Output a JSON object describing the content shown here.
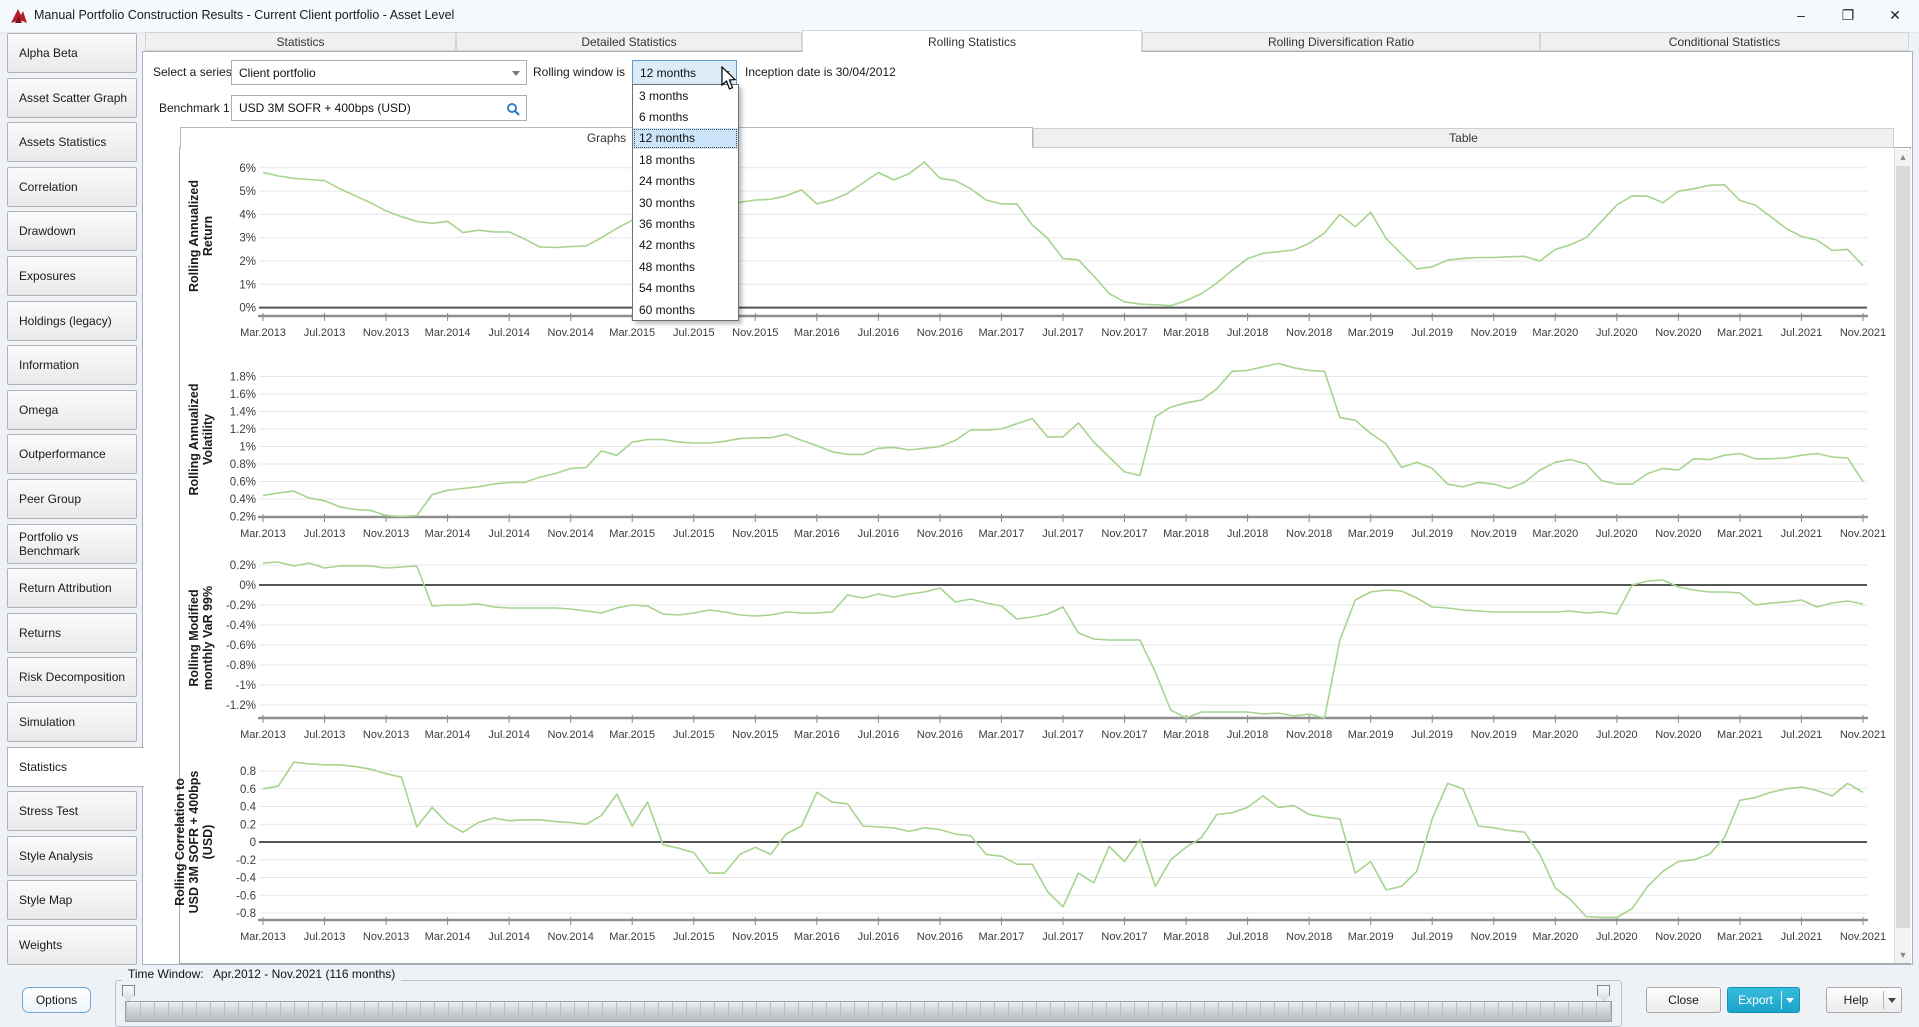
{
  "window": {
    "title": "Manual Portfolio Construction Results - Current Client portfolio - Asset Level",
    "icons": {
      "app": "portfolio-app-icon",
      "minimize": "minimize-icon",
      "restore": "restore-icon",
      "close": "close-icon"
    }
  },
  "sidebar": {
    "items": [
      "Alpha Beta",
      "Asset Scatter Graph",
      "Assets Statistics",
      "Correlation",
      "Drawdown",
      "Exposures",
      "Holdings (legacy)",
      "Information",
      "Omega",
      "Outperformance",
      "Peer Group",
      "Portfolio vs Benchmark",
      "Return Attribution",
      "Returns",
      "Risk Decomposition",
      "Simulation",
      "Statistics",
      "Stress Test",
      "Style Analysis",
      "Style Map",
      "Weights"
    ],
    "active": "Statistics"
  },
  "tabs": {
    "items": [
      "Statistics",
      "Detailed Statistics",
      "Rolling Statistics",
      "Rolling Diversification Ratio",
      "Conditional Statistics"
    ],
    "active": "Rolling Statistics"
  },
  "controls": {
    "series_label": "Select a series",
    "series_value": "Client portfolio",
    "rolling_label": "Rolling window is",
    "rolling_value": "12 months",
    "rolling_options": [
      "3 months",
      "6 months",
      "12 months",
      "18 months",
      "24 months",
      "30 months",
      "36 months",
      "42 months",
      "48 months",
      "54 months",
      "60 months"
    ],
    "rolling_selected": "12 months",
    "inception_text": "Inception date is 30/04/2012",
    "benchmark_label": "Benchmark 1",
    "benchmark_value": "USD 3M SOFR + 400bps (USD)",
    "search_icon": "search-icon"
  },
  "subtabs": {
    "items": [
      "Graphs",
      "Table"
    ],
    "active": "Graphs"
  },
  "colors": {
    "chart_line": "#a6d48e",
    "export_button": "#29b4d6",
    "dropdown_highlight": "#cbe4fa"
  },
  "chart_data": {
    "type": "line",
    "series_name": "Client portfolio",
    "x_start": "Mar.2013",
    "x_step_months": 1,
    "x_labels": [
      "Mar.2013",
      "Jul.2013",
      "Nov.2013",
      "Mar.2014",
      "Jul.2014",
      "Nov.2014",
      "Mar.2015",
      "Jul.2015",
      "Nov.2015",
      "Mar.2016",
      "Jul.2016",
      "Nov.2016",
      "Mar.2017",
      "Jul.2017",
      "Nov.2017",
      "Mar.2018",
      "Jul.2018",
      "Nov.2018",
      "Mar.2019",
      "Jul.2019",
      "Nov.2019",
      "Mar.2020",
      "Jul.2020",
      "Nov.2020",
      "Mar.2021",
      "Jul.2021",
      "Nov.2021"
    ],
    "charts": [
      {
        "ylabel_lines": [
          "Rolling Annualized",
          "Return"
        ],
        "ytick_values": [
          6,
          5,
          4,
          3,
          2,
          1,
          0
        ],
        "ytick_labels": [
          "6%",
          "5%",
          "4%",
          "3%",
          "2%",
          "1%",
          "0%"
        ],
        "ylim": [
          -0.4,
          6.5
        ],
        "values": [
          5.8,
          5.65,
          5.55,
          5.5,
          5.45,
          5.1,
          4.8,
          4.5,
          4.15,
          3.9,
          3.7,
          3.62,
          3.7,
          3.22,
          3.32,
          3.25,
          3.25,
          2.95,
          2.6,
          2.58,
          2.62,
          2.65,
          3.0,
          3.4,
          3.75,
          3.95,
          4.1,
          4.2,
          4.28,
          4.35,
          4.45,
          4.52,
          4.62,
          4.65,
          4.8,
          5.05,
          4.45,
          4.62,
          4.9,
          5.35,
          5.8,
          5.48,
          5.75,
          6.25,
          5.55,
          5.45,
          5.1,
          4.62,
          4.45,
          4.45,
          3.55,
          2.97,
          2.1,
          2.05,
          1.35,
          0.6,
          0.25,
          0.15,
          0.12,
          0.08,
          0.3,
          0.6,
          1.05,
          1.6,
          2.1,
          2.33,
          2.4,
          2.47,
          2.76,
          3.2,
          4.0,
          3.47,
          4.09,
          2.97,
          2.3,
          1.66,
          1.75,
          2.04,
          2.11,
          2.15,
          2.15,
          2.18,
          2.2,
          2.0,
          2.5,
          2.7,
          3.0,
          3.7,
          4.4,
          4.8,
          4.78,
          4.5,
          5.0,
          5.1,
          5.25,
          5.27,
          4.6,
          4.4,
          3.9,
          3.4,
          3.05,
          2.9,
          2.45,
          2.5,
          1.8
        ]
      },
      {
        "ylabel_lines": [
          "Rolling Annualized",
          "Volatility"
        ],
        "ytick_values": [
          1.8,
          1.6,
          1.4,
          1.2,
          1.0,
          0.8,
          0.6,
          0.4,
          0.2
        ],
        "ytick_labels": [
          "1.8%",
          "1.6%",
          "1.4%",
          "1.2%",
          "1%",
          "0.8%",
          "0.6%",
          "0.4%",
          "0.2%"
        ],
        "ylim": [
          0.2,
          2.0
        ],
        "values": [
          0.44,
          0.47,
          0.49,
          0.41,
          0.38,
          0.31,
          0.28,
          0.27,
          0.21,
          0.2,
          0.21,
          0.45,
          0.5,
          0.52,
          0.54,
          0.57,
          0.59,
          0.59,
          0.65,
          0.69,
          0.75,
          0.76,
          0.95,
          0.9,
          1.05,
          1.08,
          1.08,
          1.05,
          1.04,
          1.04,
          1.06,
          1.09,
          1.1,
          1.1,
          1.14,
          1.07,
          1.01,
          0.94,
          0.91,
          0.91,
          0.98,
          0.99,
          0.96,
          0.98,
          1.0,
          1.07,
          1.19,
          1.19,
          1.2,
          1.26,
          1.32,
          1.11,
          1.11,
          1.27,
          1.05,
          0.88,
          0.71,
          0.67,
          1.34,
          1.45,
          1.5,
          1.53,
          1.66,
          1.86,
          1.87,
          1.91,
          1.95,
          1.9,
          1.87,
          1.86,
          1.33,
          1.3,
          1.15,
          1.03,
          0.76,
          0.82,
          0.75,
          0.57,
          0.54,
          0.59,
          0.57,
          0.52,
          0.59,
          0.73,
          0.82,
          0.85,
          0.8,
          0.61,
          0.57,
          0.57,
          0.69,
          0.75,
          0.73,
          0.86,
          0.85,
          0.9,
          0.92,
          0.86,
          0.86,
          0.87,
          0.9,
          0.92,
          0.88,
          0.87,
          0.6
        ]
      },
      {
        "ylabel_lines": [
          "Rolling Modified",
          "monthly VaR 99%"
        ],
        "ytick_values": [
          0.2,
          0,
          -0.2,
          -0.4,
          -0.6,
          -0.8,
          -1.0,
          -1.2
        ],
        "ytick_labels": [
          "0.2%",
          "0%",
          "-0.2%",
          "-0.4%",
          "-0.6%",
          "-0.8%",
          "-1%",
          "-1.2%"
        ],
        "ylim": [
          -1.33,
          0.3
        ],
        "values": [
          0.22,
          0.23,
          0.19,
          0.22,
          0.17,
          0.19,
          0.19,
          0.19,
          0.17,
          0.18,
          0.19,
          -0.21,
          -0.2,
          -0.2,
          -0.19,
          -0.22,
          -0.23,
          -0.23,
          -0.23,
          -0.23,
          -0.24,
          -0.26,
          -0.28,
          -0.23,
          -0.2,
          -0.21,
          -0.29,
          -0.3,
          -0.28,
          -0.25,
          -0.27,
          -0.3,
          -0.31,
          -0.3,
          -0.27,
          -0.28,
          -0.28,
          -0.27,
          -0.1,
          -0.13,
          -0.09,
          -0.12,
          -0.09,
          -0.07,
          -0.03,
          -0.17,
          -0.14,
          -0.18,
          -0.21,
          -0.34,
          -0.32,
          -0.29,
          -0.22,
          -0.48,
          -0.54,
          -0.55,
          -0.55,
          -0.55,
          -0.87,
          -1.25,
          -1.33,
          -1.27,
          -1.27,
          -1.27,
          -1.27,
          -1.29,
          -1.28,
          -1.31,
          -1.29,
          -1.33,
          -0.55,
          -0.15,
          -0.07,
          -0.05,
          -0.06,
          -0.13,
          -0.22,
          -0.23,
          -0.25,
          -0.26,
          -0.27,
          -0.27,
          -0.27,
          -0.27,
          -0.27,
          -0.26,
          -0.28,
          -0.27,
          -0.29,
          0.0,
          0.04,
          0.05,
          -0.02,
          -0.05,
          -0.07,
          -0.07,
          -0.08,
          -0.2,
          -0.18,
          -0.17,
          -0.15,
          -0.22,
          -0.18,
          -0.16,
          -0.19
        ]
      },
      {
        "ylabel_lines": [
          "Rolling Correlation to",
          "USD 3M SOFR + 400bps",
          "(USD)"
        ],
        "ytick_values": [
          0.8,
          0.6,
          0.4,
          0.2,
          0,
          -0.2,
          -0.4,
          -0.6,
          -0.8
        ],
        "ytick_labels": [
          "0.8",
          "0.6",
          "0.4",
          "0.2",
          "0",
          "-0.2",
          "-0.4",
          "-0.6",
          "-0.8"
        ],
        "ylim": [
          -0.88,
          0.95
        ],
        "values": [
          0.6,
          0.63,
          0.9,
          0.88,
          0.87,
          0.87,
          0.85,
          0.82,
          0.77,
          0.73,
          0.17,
          0.39,
          0.21,
          0.11,
          0.22,
          0.27,
          0.24,
          0.25,
          0.25,
          0.23,
          0.22,
          0.2,
          0.3,
          0.54,
          0.18,
          0.45,
          -0.03,
          -0.07,
          -0.12,
          -0.35,
          -0.35,
          -0.14,
          -0.06,
          -0.14,
          0.09,
          0.18,
          0.56,
          0.45,
          0.43,
          0.18,
          0.17,
          0.16,
          0.12,
          0.16,
          0.14,
          0.09,
          0.07,
          -0.14,
          -0.16,
          -0.25,
          -0.25,
          -0.56,
          -0.73,
          -0.35,
          -0.46,
          -0.05,
          -0.22,
          0.03,
          -0.5,
          -0.2,
          -0.06,
          0.05,
          0.31,
          0.33,
          0.39,
          0.52,
          0.39,
          0.41,
          0.31,
          0.28,
          0.26,
          -0.35,
          -0.22,
          -0.54,
          -0.5,
          -0.33,
          0.26,
          0.66,
          0.6,
          0.18,
          0.16,
          0.13,
          0.11,
          -0.14,
          -0.52,
          -0.65,
          -0.84,
          -0.85,
          -0.85,
          -0.75,
          -0.5,
          -0.33,
          -0.22,
          -0.2,
          -0.14,
          0.05,
          0.47,
          0.5,
          0.56,
          0.6,
          0.62,
          0.58,
          0.52,
          0.66,
          0.56
        ]
      }
    ]
  },
  "footer": {
    "time_window_label": "Time Window:",
    "time_window_value": "Apr.2012 - Nov.2021 (116 months)",
    "options_label": "Options",
    "close_label": "Close",
    "export_label": "Export",
    "help_label": "Help"
  }
}
